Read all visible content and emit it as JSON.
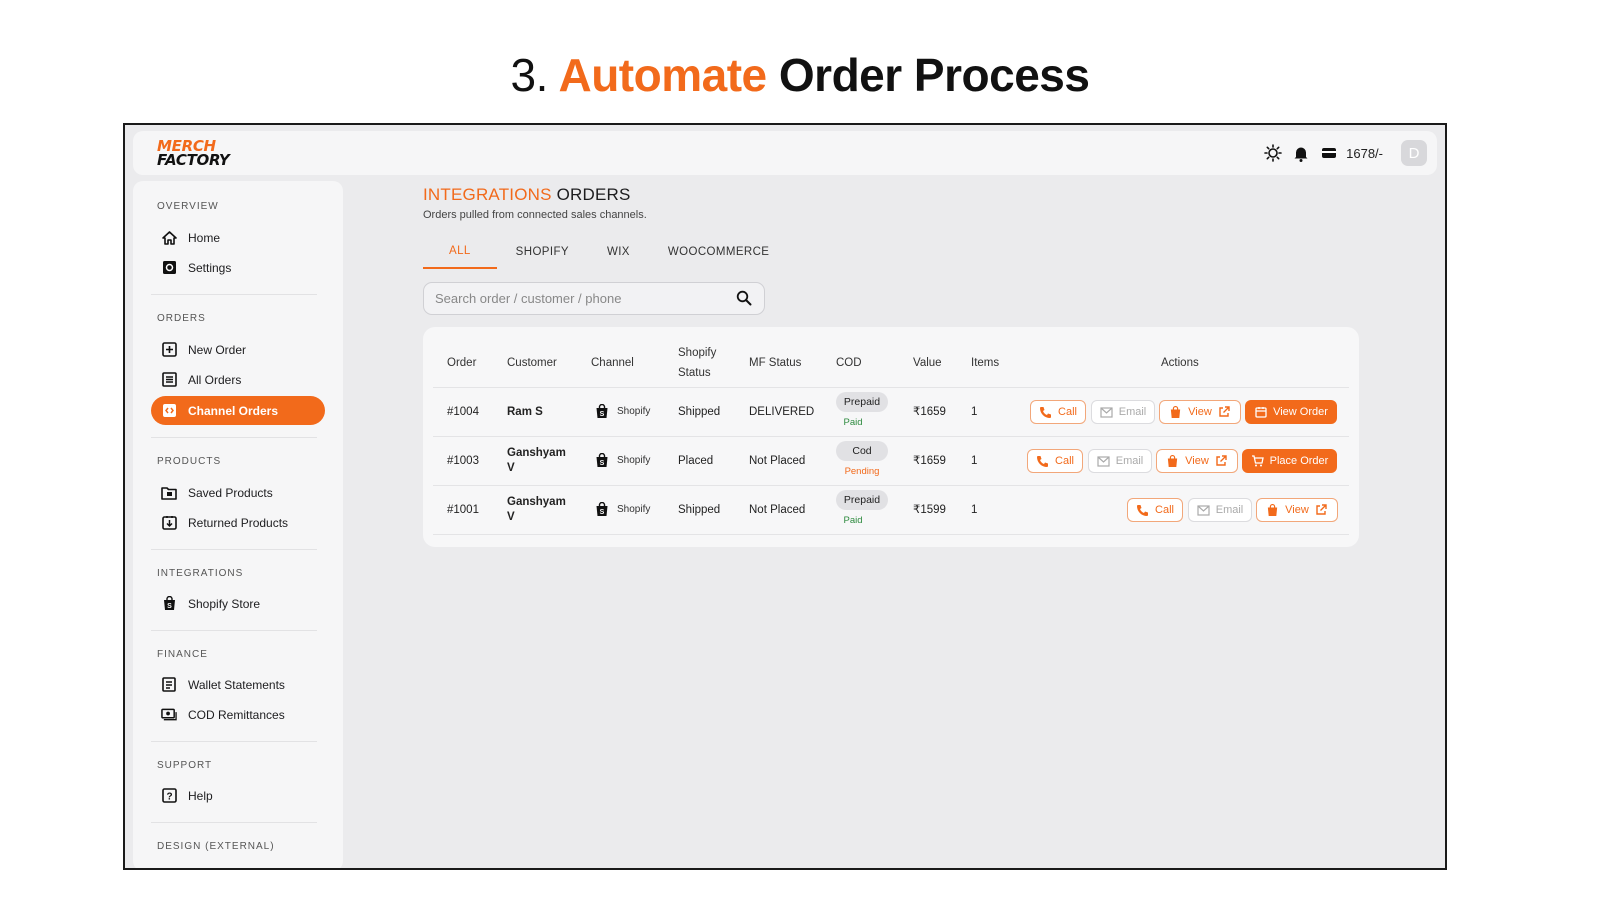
{
  "headline": {
    "number": "3.",
    "accent": "Automate",
    "rest": "Order Process"
  },
  "brand": {
    "line1": "MERCH",
    "line2": "FACTORY"
  },
  "topbar": {
    "wallet_balance": "1678/-",
    "avatar_initial": "D"
  },
  "colors": {
    "accent": "#f26a1b",
    "paid": "#2d8a3e",
    "pending": "#f26a1b"
  },
  "sidebar": {
    "sections": [
      {
        "title": "OVERVIEW",
        "items": [
          {
            "label": "Home",
            "icon": "home-icon"
          },
          {
            "label": "Settings",
            "icon": "settings-icon"
          }
        ]
      },
      {
        "title": "ORDERS",
        "items": [
          {
            "label": "New Order",
            "icon": "plus-square-icon"
          },
          {
            "label": "All Orders",
            "icon": "list-icon"
          },
          {
            "label": "Channel Orders",
            "icon": "channel-icon",
            "active": true
          }
        ]
      },
      {
        "title": "PRODUCTS",
        "items": [
          {
            "label": "Saved Products",
            "icon": "folder-icon"
          },
          {
            "label": "Returned Products",
            "icon": "return-box-icon"
          }
        ]
      },
      {
        "title": "INTEGRATIONS",
        "items": [
          {
            "label": "Shopify Store",
            "icon": "shopify-bag-icon"
          }
        ]
      },
      {
        "title": "FINANCE",
        "items": [
          {
            "label": "Wallet Statements",
            "icon": "statement-icon"
          },
          {
            "label": "COD Remittances",
            "icon": "cash-icon"
          }
        ]
      },
      {
        "title": "SUPPORT",
        "items": [
          {
            "label": "Help",
            "icon": "help-icon"
          }
        ]
      },
      {
        "title": "DESIGN (EXTERNAL)",
        "items": []
      }
    ]
  },
  "main": {
    "title_accent": "INTEGRATIONS",
    "title_rest": "ORDERS",
    "subtitle": "Orders pulled from connected sales channels.",
    "tabs": [
      "ALL",
      "SHOPIFY",
      "WIX",
      "WOOCOMMERCE"
    ],
    "active_tab": "ALL",
    "search_placeholder": "Search order / customer / phone"
  },
  "table": {
    "headers": {
      "order": "Order",
      "customer": "Customer",
      "channel": "Channel",
      "shopify_status_l1": "Shopify",
      "shopify_status_l2": "Status",
      "mf_status": "MF Status",
      "cod": "COD",
      "value": "Value",
      "items": "Items",
      "actions": "Actions"
    },
    "rows": [
      {
        "order": "#1004",
        "customer_l1": "Ram S",
        "customer_l2": "",
        "channel": "Shopify",
        "shopify_status": "Shipped",
        "mf_status": "DELIVERED",
        "cod": "Prepaid",
        "cod_status": "Paid",
        "value": "₹1659",
        "items": "1",
        "primary_action": "View Order"
      },
      {
        "order": "#1003",
        "customer_l1": "Ganshyam",
        "customer_l2": "V",
        "channel": "Shopify",
        "shopify_status": "Placed",
        "mf_status": "Not Placed",
        "cod": "Cod",
        "cod_status": "Pending",
        "value": "₹1659",
        "items": "1",
        "primary_action": "Place Order"
      },
      {
        "order": "#1001",
        "customer_l1": "Ganshyam",
        "customer_l2": "V",
        "channel": "Shopify",
        "shopify_status": "Shipped",
        "mf_status": "Not Placed",
        "cod": "Prepaid",
        "cod_status": "Paid",
        "value": "₹1599",
        "items": "1",
        "primary_action": ""
      }
    ],
    "action_labels": {
      "call": "Call",
      "email": "Email",
      "view": "View"
    }
  }
}
